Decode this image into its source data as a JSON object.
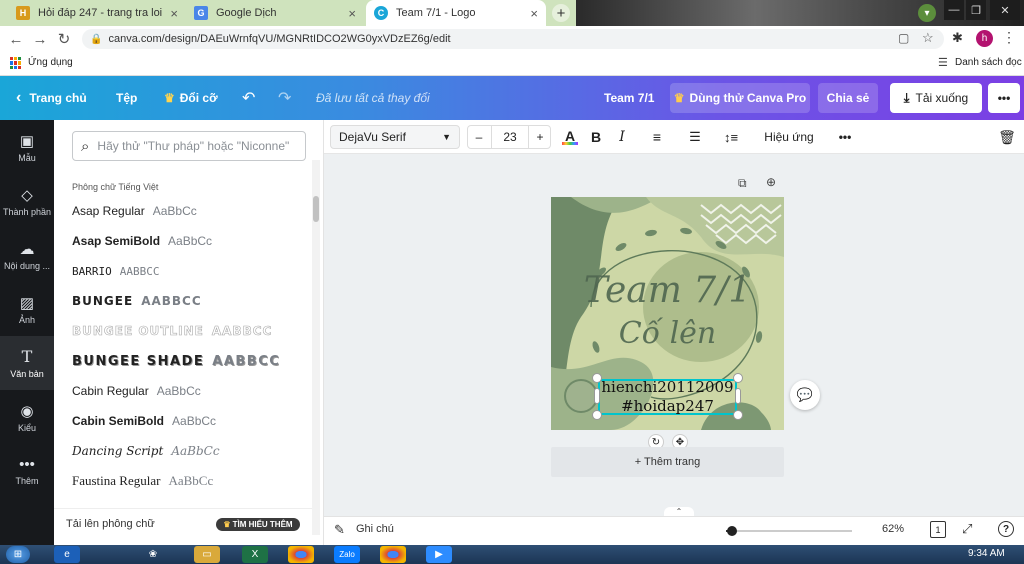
{
  "browser": {
    "tabs": [
      {
        "title": "Hỏi đáp 247 - trang tra loi",
        "active": false
      },
      {
        "title": "Google Dịch",
        "active": false
      },
      {
        "title": "Team 7/1 - Logo",
        "active": true
      }
    ],
    "new_tab": "+",
    "url": "canva.com/design/DAEuWrnfqVU/MGNRtIDCO2WG0yxVDzEZ6g/edit",
    "avatar_letter": "h",
    "bookmarks": {
      "apps": "Ứng dụng",
      "reading_list": "Danh sách đọc"
    }
  },
  "header": {
    "home": "Trang chủ",
    "file": "Tệp",
    "resize": "Đổi cỡ",
    "saved_status": "Đã lưu tất cả thay đổi",
    "design_title": "Team 7/1",
    "try_pro": "Dùng thử Canva Pro",
    "share": "Chia sẻ",
    "download": "Tải xuống",
    "more": "•••"
  },
  "rail": [
    {
      "label": "Mẫu",
      "icon": "template-icon"
    },
    {
      "label": "Thành phần",
      "icon": "elements-icon"
    },
    {
      "label": "Nội dung ...",
      "icon": "upload-icon"
    },
    {
      "label": "Ảnh",
      "icon": "photo-icon"
    },
    {
      "label": "Văn bản",
      "icon": "text-icon"
    },
    {
      "label": "Kiểu",
      "icon": "style-icon"
    },
    {
      "label": "Thêm",
      "icon": "more-icon"
    }
  ],
  "font_panel": {
    "search_placeholder": "Hãy thử \"Thư pháp\" hoặc \"Niconne\"",
    "section_title": "Phông chữ Tiếng Việt",
    "fonts": [
      {
        "name": "Asap Regular",
        "sample": "AaBbCc"
      },
      {
        "name": "Asap SemiBold",
        "sample": "AaBbCc"
      },
      {
        "name": "BARRIO",
        "sample": "AABBCC"
      },
      {
        "name": "BUNGEE",
        "sample": "AABBCC"
      },
      {
        "name": "BUNGEE OUTLINE",
        "sample": "AABBCC"
      },
      {
        "name": "BUNGEE SHADE",
        "sample": "AABBCC"
      },
      {
        "name": "Cabin Regular",
        "sample": "AaBbCc"
      },
      {
        "name": "Cabin SemiBold",
        "sample": "AaBbCc"
      },
      {
        "name": "Dancing Script",
        "sample": "AaBbCc"
      },
      {
        "name": "Faustina Regular",
        "sample": "AaBbCc"
      }
    ],
    "upload_font": "Tải lên phông chữ",
    "learn_more": "TÌM HIỂU THÊM"
  },
  "toolbar": {
    "font_family": "DejaVu Serif",
    "minus": "–",
    "font_size": "23",
    "plus": "+",
    "text_color_glyph": "A",
    "bold": "B",
    "italic": "I",
    "effects": "Hiệu ứng",
    "more": "•••"
  },
  "design": {
    "title_line1": "Team 7/1",
    "title_line2": "Cố lên",
    "selected_line1": "hienchi20112009",
    "selected_line2": "#hoidap247",
    "add_page": "+ Thêm trang"
  },
  "bottom": {
    "notes": "Ghi chú",
    "zoom": "62%",
    "zoom_fraction": 0.05,
    "page_number": "1",
    "help": "?"
  },
  "taskbar": {
    "time": "9:34 AM",
    "zalo": "Zalo"
  },
  "colors": {
    "header_start": "#1aa6d8",
    "header_end": "#7b3fe4",
    "rail": "#17191c",
    "selection": "#00c4cc",
    "art_bg": "#c9d3a3",
    "art_dark": "#6f8a68"
  }
}
